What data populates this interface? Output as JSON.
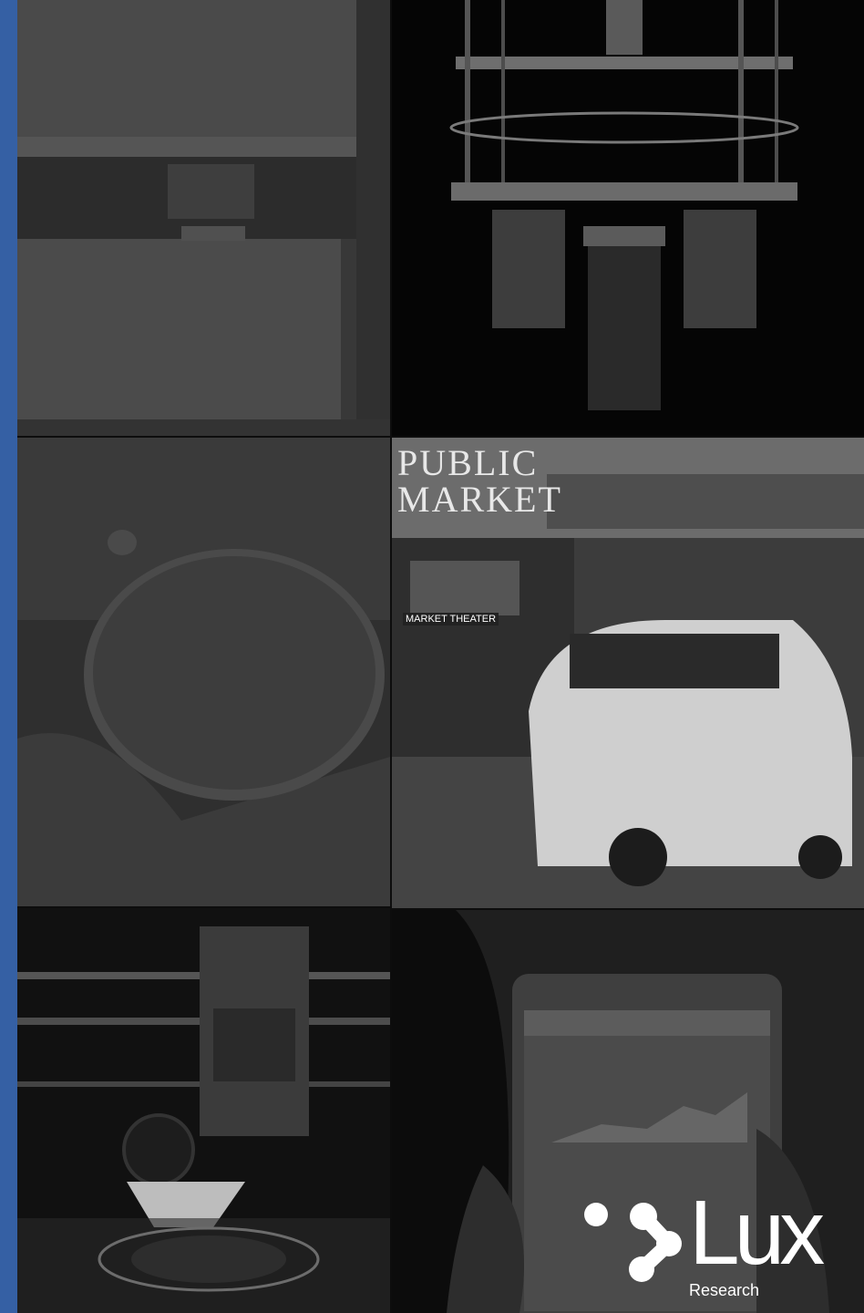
{
  "brand": {
    "name": "Lux",
    "tagline": "Research",
    "logo_color": "#ffffff",
    "accent_color": "#3560a4"
  },
  "photo_text": {
    "market_sign": "PUBLIC MARKET",
    "theater_sign": "MARKET THEATER"
  },
  "tiles": [
    {
      "name": "battery-cells-photo"
    },
    {
      "name": "quantum-computer-photo"
    },
    {
      "name": "petri-dish-photo"
    },
    {
      "name": "electric-car-market-photo"
    },
    {
      "name": "3d-printer-photo"
    },
    {
      "name": "tablet-dashboard-photo"
    }
  ]
}
